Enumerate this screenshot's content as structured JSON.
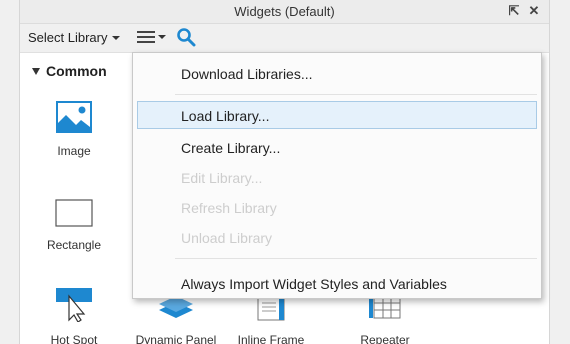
{
  "window": {
    "title": "Widgets (Default)",
    "pin_glyph": "⇱",
    "close_glyph": "✕"
  },
  "toolbar": {
    "select_library_label": "Select Library",
    "menu_icon": "hamburger-menu-icon",
    "search_icon": "search-icon"
  },
  "section": {
    "label": "Common"
  },
  "widgets": [
    {
      "label": "Image",
      "icon": "image-icon"
    },
    {
      "label": "Rectangle",
      "icon": "rectangle-icon"
    },
    {
      "label": "Hot Spot",
      "icon": "hot-spot-icon"
    },
    {
      "label": "Dynamic Panel",
      "icon": "dynamic-panel-icon"
    },
    {
      "label": "Inline Frame",
      "icon": "inline-frame-icon"
    },
    {
      "label": "Repeater",
      "icon": "repeater-icon"
    }
  ],
  "menu": {
    "items": [
      {
        "label": "Download Libraries...",
        "enabled": true
      },
      {
        "label": "Load Library...",
        "enabled": true,
        "highlighted": true
      },
      {
        "label": "Create Library...",
        "enabled": true
      },
      {
        "label": "Edit Library...",
        "enabled": false
      },
      {
        "label": "Refresh Library",
        "enabled": false
      },
      {
        "label": "Unload Library",
        "enabled": false
      },
      {
        "label": "Always Import Widget Styles and Variables",
        "enabled": true
      }
    ]
  },
  "colors": {
    "accent_blue": "#1e88d0",
    "highlight_bg": "#e5f1fb",
    "highlight_border": "#a9cbe6",
    "disabled_text": "#cdcdcd"
  }
}
